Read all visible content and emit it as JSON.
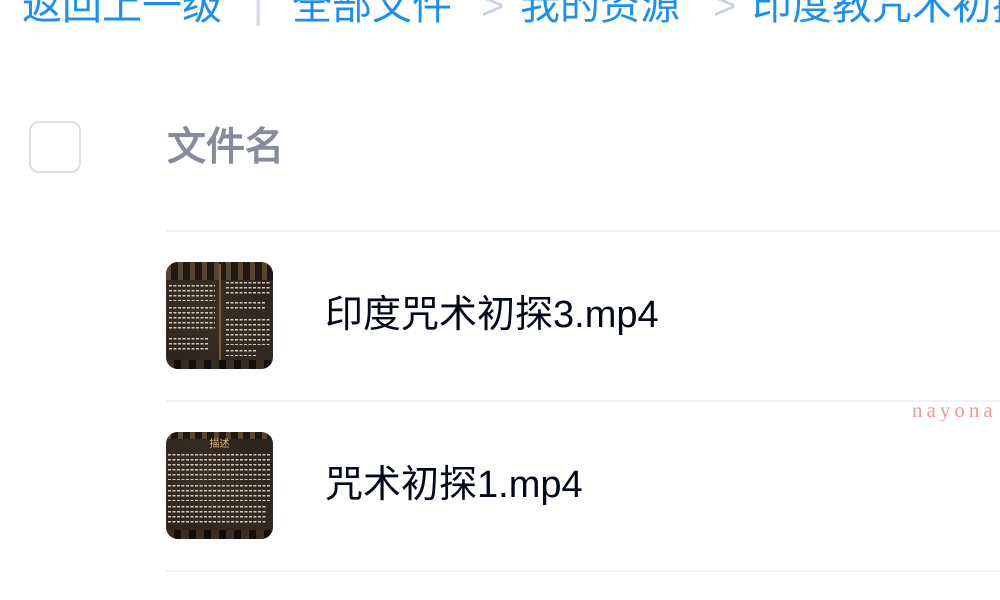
{
  "breadcrumb": {
    "back_label": "返回上一级",
    "divider": "|",
    "chevron": ">",
    "items": [
      "全部文件",
      "我的资源",
      "印度教咒术初探"
    ]
  },
  "file_list": {
    "columns": {
      "name": "文件名"
    },
    "rows": [
      {
        "name": "印度咒术初探3.mp4"
      },
      {
        "name": "咒术初探1.mp4",
        "thumbnail_caption": "描述"
      }
    ]
  },
  "watermark": "nayona",
  "colors": {
    "accent": "#1e90ec",
    "text": "#03081a",
    "column-header": "#878c9c",
    "breadcrumb-separator": "#c9d3e1",
    "divider": "#f1f2f4",
    "checkbox-border": "#dcdfe6",
    "watermark": "#ef9a9a"
  }
}
